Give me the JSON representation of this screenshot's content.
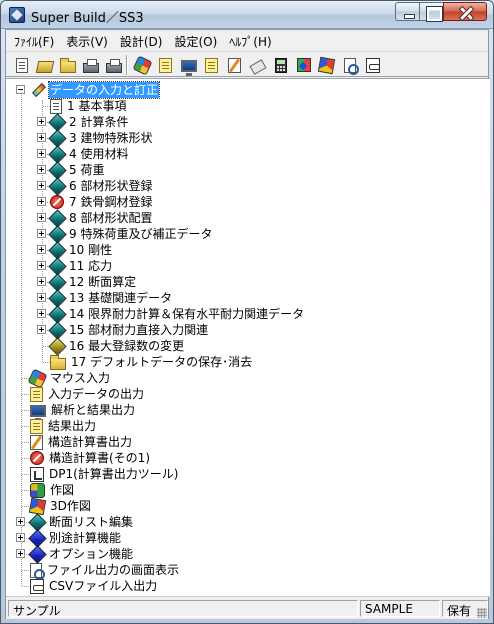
{
  "window": {
    "title": "Super Build／SS3"
  },
  "menu": [
    "ﾌｧｲﾙ(F)",
    "表示(V)",
    "設計(D)",
    "設定(O)",
    "ﾍﾙﾌﾟ(H)"
  ],
  "toolbar": [
    {
      "name": "new-document-icon",
      "icon": "doc"
    },
    {
      "name": "open-folder-icon",
      "icon": "folderopen"
    },
    {
      "name": "folder-icon",
      "icon": "folder"
    },
    {
      "name": "print-icon",
      "icon": "printer"
    },
    {
      "name": "print-preview-icon",
      "icon": "printer"
    },
    {
      "name": "mouse-input-icon",
      "icon": "mouse"
    },
    {
      "name": "data-output-icon",
      "icon": "note"
    },
    {
      "name": "analysis-icon",
      "icon": "monitor"
    },
    {
      "name": "result-output-icon",
      "icon": "note"
    },
    {
      "name": "calc-sheet-icon",
      "icon": "pencil"
    },
    {
      "name": "structural-calc-icon",
      "icon": "tag"
    },
    {
      "name": "dp1-icon",
      "icon": "calc"
    },
    {
      "name": "drawing-icon",
      "icon": "book"
    },
    {
      "name": "3d-drawing-icon",
      "icon": "cube"
    },
    {
      "name": "screen-display-icon",
      "icon": "search"
    },
    {
      "name": "csv-icon",
      "icon": "csv"
    }
  ],
  "tree": {
    "root": "データの入力と訂正",
    "children": [
      {
        "label": "1 基本事項",
        "icon": "doc",
        "expander": false
      },
      {
        "label": "2 計算条件",
        "icon": "diamond",
        "expander": true
      },
      {
        "label": "3 建物特殊形状",
        "icon": "diamond",
        "expander": true
      },
      {
        "label": "4 使用材料",
        "icon": "diamond",
        "expander": true
      },
      {
        "label": "5 荷重",
        "icon": "diamond",
        "expander": true
      },
      {
        "label": "6 部材形状登録",
        "icon": "diamond",
        "expander": true
      },
      {
        "label": "7 鉄骨鋼材登録",
        "icon": "redcircle",
        "expander": true
      },
      {
        "label": "8 部材形状配置",
        "icon": "diamond",
        "expander": true
      },
      {
        "label": "9 特殊荷重及び補正データ",
        "icon": "diamond",
        "expander": true
      },
      {
        "label": "10 剛性",
        "icon": "diamond",
        "expander": true
      },
      {
        "label": "11 応力",
        "icon": "diamond",
        "expander": true
      },
      {
        "label": "12 断面算定",
        "icon": "diamond",
        "expander": true
      },
      {
        "label": "13 基礎関連データ",
        "icon": "diamond",
        "expander": true
      },
      {
        "label": "14 限界耐力計算＆保有水平耐力関連データ",
        "icon": "diamond",
        "expander": true
      },
      {
        "label": "15 部材耐力直接入力関連",
        "icon": "diamond",
        "expander": true
      },
      {
        "label": "16 最大登録数の変更",
        "icon": "diamond-gold",
        "expander": false
      },
      {
        "label": "17 デフォルトデータの保存･消去",
        "icon": "folder",
        "expander": false
      }
    ],
    "top_items": [
      {
        "label": "マウス入力",
        "icon": "mouse",
        "expander": false
      },
      {
        "label": "入力データの出力",
        "icon": "note",
        "expander": false
      },
      {
        "label": "解析と結果出力",
        "icon": "monitor",
        "expander": false
      },
      {
        "label": "結果出力",
        "icon": "note",
        "expander": false
      },
      {
        "label": "構造計算書出力",
        "icon": "pencil",
        "expander": false
      },
      {
        "label": "構造計算書(その1)",
        "icon": "redcircle",
        "expander": false
      },
      {
        "label": "DP1(計算書出力ツール)",
        "icon": "dp1",
        "expander": false
      },
      {
        "label": "作図",
        "icon": "figure",
        "expander": false
      },
      {
        "label": "3D作図",
        "icon": "cube",
        "expander": false
      },
      {
        "label": "断面リスト編集",
        "icon": "diamond",
        "expander": true
      },
      {
        "label": "別途計算機能",
        "icon": "diamond-blue",
        "expander": true
      },
      {
        "label": "オプション機能",
        "icon": "diamond-blue",
        "expander": true
      },
      {
        "label": "ファイル出力の画面表示",
        "icon": "search",
        "expander": false
      },
      {
        "label": "CSVファイル入出力",
        "icon": "csv",
        "expander": false
      }
    ]
  },
  "status": {
    "left": "サンプル",
    "mid": "SAMPLE",
    "right": "保有"
  }
}
